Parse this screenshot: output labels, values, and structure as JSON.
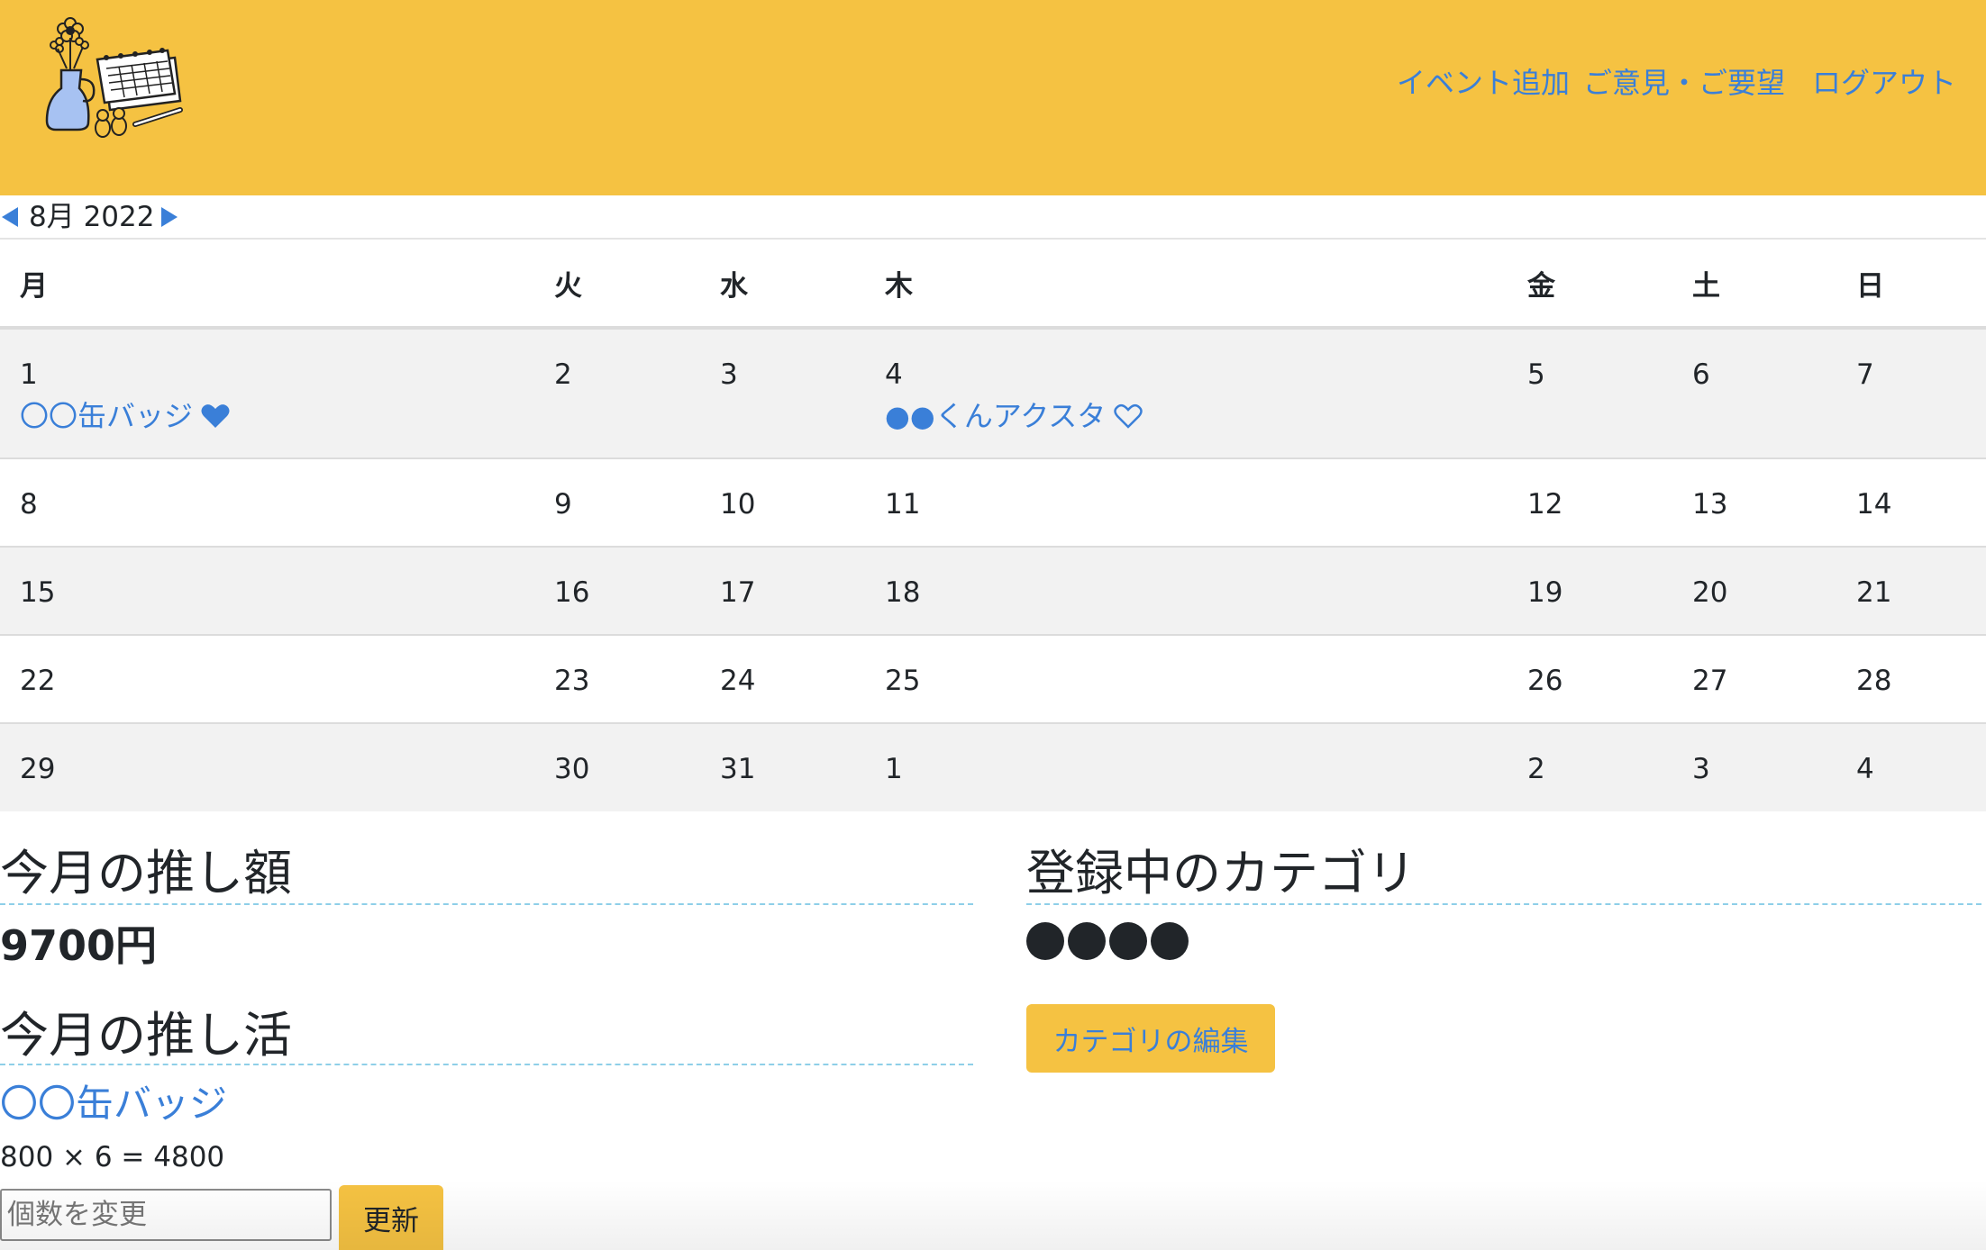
{
  "header": {
    "nav": [
      {
        "label": "イベント追加"
      },
      {
        "label": "ご意見・ご要望"
      },
      {
        "label": "ログアウト"
      }
    ],
    "background_color": "#f5c242",
    "logo_icon": "vase-and-calendar-illustration"
  },
  "month_nav": {
    "label": "8月 2022",
    "prev_icon": "triangle-left-icon",
    "next_icon": "triangle-right-icon"
  },
  "calendar": {
    "weekdays": [
      "月",
      "火",
      "水",
      "木",
      "金",
      "土",
      "日"
    ],
    "weeks": [
      [
        "1",
        "2",
        "3",
        "4",
        "5",
        "6",
        "7"
      ],
      [
        "8",
        "9",
        "10",
        "11",
        "12",
        "13",
        "14"
      ],
      [
        "15",
        "16",
        "17",
        "18",
        "19",
        "20",
        "21"
      ],
      [
        "22",
        "23",
        "24",
        "25",
        "26",
        "27",
        "28"
      ],
      [
        "29",
        "30",
        "31",
        "1",
        "2",
        "3",
        "4"
      ]
    ],
    "events": [
      {
        "label": "〇〇缶バッジ",
        "icon": "heart-filled-icon"
      },
      {
        "label": "●●くんアクスタ",
        "icon": "heart-outline-icon"
      }
    ]
  },
  "summary": {
    "amount_title": "今月の推し額",
    "amount_value": "9700円",
    "activity_title": "今月の推し活",
    "activity_item": {
      "name": "〇〇缶バッジ",
      "calc": "800 × 6 = 4800"
    },
    "quantity_placeholder": "個数を変更",
    "update_label": "更新"
  },
  "categories": {
    "title": "登録中のカテゴリ",
    "dot_count": 4,
    "edit_label": "カテゴリの編集"
  },
  "colors": {
    "accent": "#f5c242",
    "link": "#3a7fd8",
    "text": "#212529",
    "row_stripe": "#f2f2f2",
    "divider": "#8ecfe8"
  }
}
